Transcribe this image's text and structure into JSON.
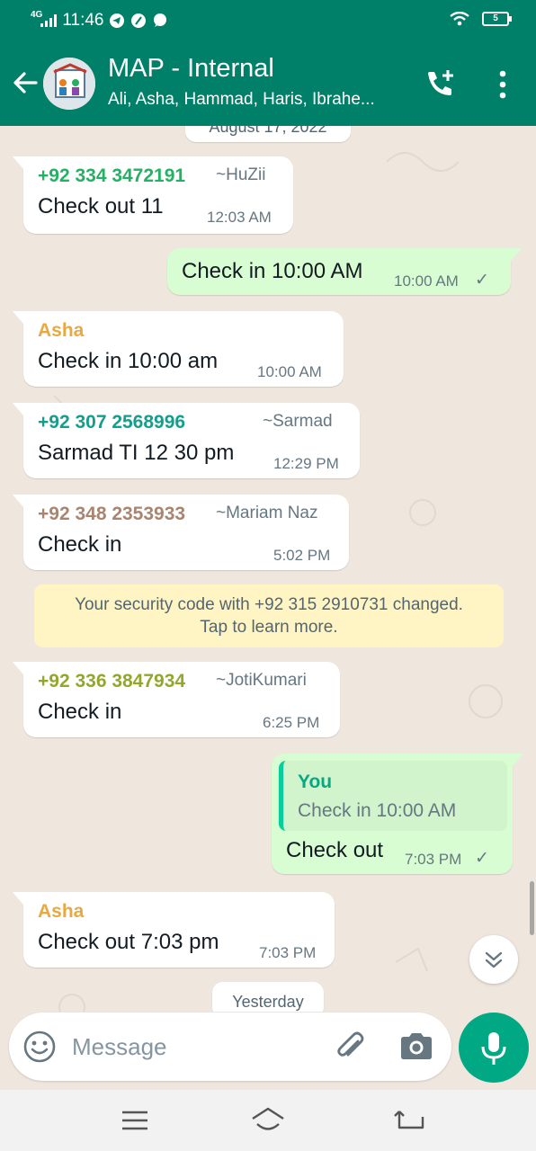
{
  "status_bar": {
    "time": "11:46",
    "network": "4G",
    "battery": "5"
  },
  "header": {
    "title": "MAP - Internal",
    "subtitle": "Ali, Asha, Hammad, Haris, Ibrahe..."
  },
  "chat": {
    "date_top": "August 17, 2022",
    "date_bottom": "Yesterday",
    "messages": [
      {
        "sender": "+92 334 3472191",
        "alias": "~HuZii",
        "text": "Check out 11",
        "time": "12:03 AM"
      },
      {
        "text": "Check in 10:00 AM",
        "time": "10:00 AM"
      },
      {
        "sender": "Asha",
        "text": "Check in 10:00 am",
        "time": "10:00 AM"
      },
      {
        "sender": "+92 307 2568996",
        "alias": "~Sarmad",
        "text": "Sarmad TI 12 30 pm",
        "time": "12:29 PM"
      },
      {
        "sender": "+92 348 2353933",
        "alias": "~Mariam Naz",
        "text": "Check in",
        "time": "5:02 PM"
      },
      {
        "sender": "+92 336 3847934",
        "alias": "~JotiKumari",
        "text": "Check in",
        "time": "6:25 PM"
      },
      {
        "quote_name": "You",
        "quote_text": "Check in 10:00 AM",
        "text": "Check out",
        "time": "7:03 PM"
      },
      {
        "sender": "Asha",
        "text": "Check out 7:03 pm",
        "time": "7:03 PM"
      }
    ],
    "system_notice": {
      "line1": "Your security code with +92 315 2910731 changed.",
      "line2": "Tap to learn more."
    }
  },
  "composer": {
    "placeholder": "Message"
  },
  "colors": {
    "header": "#008069",
    "outgoing_bubble": "#d9fdd3",
    "sender_huzii": "#25b164",
    "sender_asha": "#e8a940",
    "sender_sarmad": "#149e8c",
    "sender_mariam": "#a98570",
    "sender_joti": "#93a72d",
    "mic_button": "#00a884"
  },
  "icons": [
    "back-arrow-icon",
    "group-avatar",
    "add-call-icon",
    "more-vert-icon",
    "read-tick-icon",
    "chevrons-down-icon",
    "emoji-icon",
    "paperclip-icon",
    "camera-icon",
    "mic-icon",
    "menu-lines-icon",
    "home-icon",
    "back-nav-icon"
  ]
}
